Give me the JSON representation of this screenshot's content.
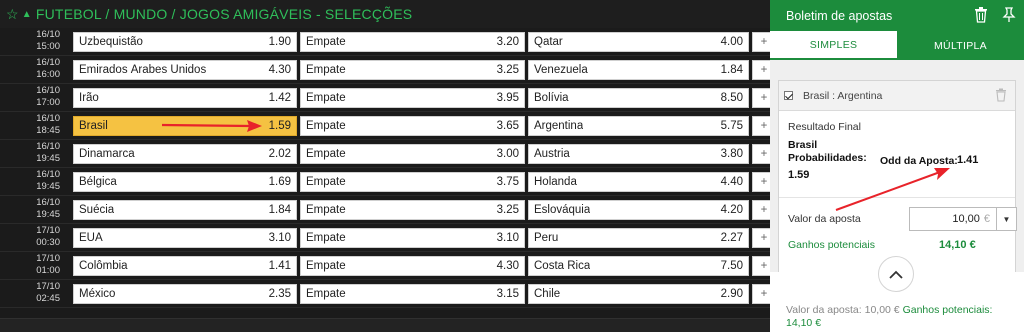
{
  "league": {
    "title": "FUTEBOL / MUNDO / JOGOS AMIGÁVEIS - SELECÇÕES"
  },
  "matches": [
    {
      "date": "16/10",
      "time": "15:00",
      "home": "Uzbequistão",
      "home_odd": "1.90",
      "draw": "Empate",
      "draw_odd": "3.20",
      "away": "Qatar",
      "away_odd": "4.00"
    },
    {
      "date": "16/10",
      "time": "16:00",
      "home": "Emirados Árabes Unidos",
      "home_odd": "4.30",
      "draw": "Empate",
      "draw_odd": "3.25",
      "away": "Venezuela",
      "away_odd": "1.84"
    },
    {
      "date": "16/10",
      "time": "17:00",
      "home": "Irão",
      "home_odd": "1.42",
      "draw": "Empate",
      "draw_odd": "3.95",
      "away": "Bolívia",
      "away_odd": "8.50"
    },
    {
      "date": "16/10",
      "time": "18:45",
      "home": "Brasil",
      "home_odd": "1.59",
      "draw": "Empate",
      "draw_odd": "3.65",
      "away": "Argentina",
      "away_odd": "5.75",
      "selected": true
    },
    {
      "date": "16/10",
      "time": "19:45",
      "home": "Dinamarca",
      "home_odd": "2.02",
      "draw": "Empate",
      "draw_odd": "3.00",
      "away": "Áustria",
      "away_odd": "3.80"
    },
    {
      "date": "16/10",
      "time": "19:45",
      "home": "Bélgica",
      "home_odd": "1.69",
      "draw": "Empate",
      "draw_odd": "3.75",
      "away": "Holanda",
      "away_odd": "4.40"
    },
    {
      "date": "16/10",
      "time": "19:45",
      "home": "Suécia",
      "home_odd": "1.84",
      "draw": "Empate",
      "draw_odd": "3.25",
      "away": "Eslováquia",
      "away_odd": "4.20"
    },
    {
      "date": "17/10",
      "time": "00:30",
      "home": "EUA",
      "home_odd": "3.10",
      "draw": "Empate",
      "draw_odd": "3.10",
      "away": "Peru",
      "away_odd": "2.27"
    },
    {
      "date": "17/10",
      "time": "01:00",
      "home": "Colômbia",
      "home_odd": "1.41",
      "draw": "Empate",
      "draw_odd": "4.30",
      "away": "Costa Rica",
      "away_odd": "7.50"
    },
    {
      "date": "17/10",
      "time": "02:45",
      "home": "México",
      "home_odd": "2.35",
      "draw": "Empate",
      "draw_odd": "3.15",
      "away": "Chile",
      "away_odd": "2.90"
    }
  ],
  "more_glyph": "+",
  "slip": {
    "title": "Boletim de apostas",
    "tab_single": "SIMPLES",
    "tab_multiple": "MÚLTIPLA",
    "selection": "Brasil : Argentina",
    "market": "Resultado Final",
    "pick": "Brasil",
    "prob_label": "Probabilidades:",
    "prob_value": "1.59",
    "odd_label": "Odd da Aposta:",
    "odd_value": "1.41",
    "stake_label": "Valor da aposta",
    "stake_value": "10,00",
    "currency": "€",
    "potential_label": "Ganhos potenciais",
    "potential_value": "14,10 €",
    "summary_stake": "Valor da aposta: 10,00 €",
    "summary_potential": "Ganhos potenciais:",
    "summary_potential_value": "14,10 €"
  },
  "colors": {
    "brand_green": "#1c8c3c",
    "header_green": "#2fbf5a",
    "selected": "#f5c242",
    "arrow_red": "#e8232a"
  }
}
